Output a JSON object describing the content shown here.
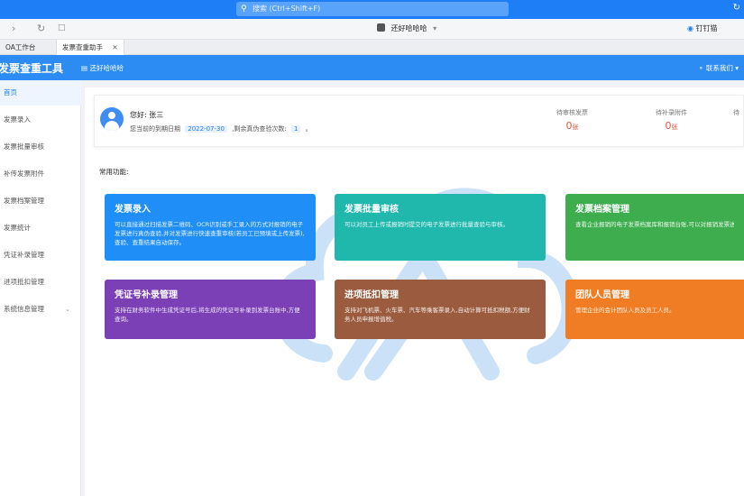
{
  "search": {
    "placeholder": "搜索 (Ctrl+Shift+F)"
  },
  "toolbar": {
    "workspace": "还好哈哈哈",
    "dingding": "钉钉猫"
  },
  "tabs": [
    {
      "label": "OA工作台"
    },
    {
      "label": "发票查重助手"
    }
  ],
  "header": {
    "app_title": "发票查重工具",
    "workspace": "还好哈哈哈",
    "contact": "联系我们"
  },
  "sidebar": {
    "items": [
      {
        "label": "首页"
      },
      {
        "label": "发票录入"
      },
      {
        "label": "发票批量审核"
      },
      {
        "label": "补传发票附件"
      },
      {
        "label": "发票档案管理"
      },
      {
        "label": "发票统计"
      },
      {
        "label": "凭证补录管理"
      },
      {
        "label": "进项抵扣管理"
      },
      {
        "label": "系统信息管理"
      }
    ]
  },
  "user": {
    "greeting": "您好:",
    "name": "张三",
    "expire_label": "您当前的到期日期",
    "expire_date": "2022-07-30",
    "remain_label": ",剩余真伪查验次数:",
    "remain_count": "1",
    "remain_suffix": "。"
  },
  "stats": [
    {
      "label": "待审核发票",
      "value": "0",
      "unit": "张"
    },
    {
      "label": "待补录附件",
      "value": "0",
      "unit": "张"
    },
    {
      "label": "待",
      "value": "",
      "unit": ""
    }
  ],
  "section_title": "常用功能:",
  "cards": [
    {
      "title": "发票录入",
      "desc": "可以直接通过扫描发票二维码、OCR识别或手工录入的方式对报销的电子发票进行真伪查验,并对发票进行快速查重审核(若员工已预填或上传发票),查验、查重结果自动保存。",
      "color": "#1f8ff7"
    },
    {
      "title": "发票批量审核",
      "desc": "可以对员工上传或报销时提交的电子发票进行批量查验与审核。",
      "color": "#20b8ad"
    },
    {
      "title": "发票档案管理",
      "desc": "查看企业报销的电子发票档案库和报销台账,可以对报销发票进行管理。",
      "color": "#3dad4e"
    },
    {
      "title": "凭证号补录管理",
      "desc": "支持在财务软件中生成凭证号后,将生成的凭证号补录到发票台账中,方便查询。",
      "color": "#7b3fb6"
    },
    {
      "title": "进项抵扣管理",
      "desc": "支持对飞机票、火车票、汽车等乘客票录入,自动计算可抵扣税额,方便财务人员申报增值税。",
      "color": "#9a5b3e"
    },
    {
      "title": "团队人员管理",
      "desc": "管理企业的会计团队人员及员工人员。",
      "color": "#f07d23"
    }
  ]
}
